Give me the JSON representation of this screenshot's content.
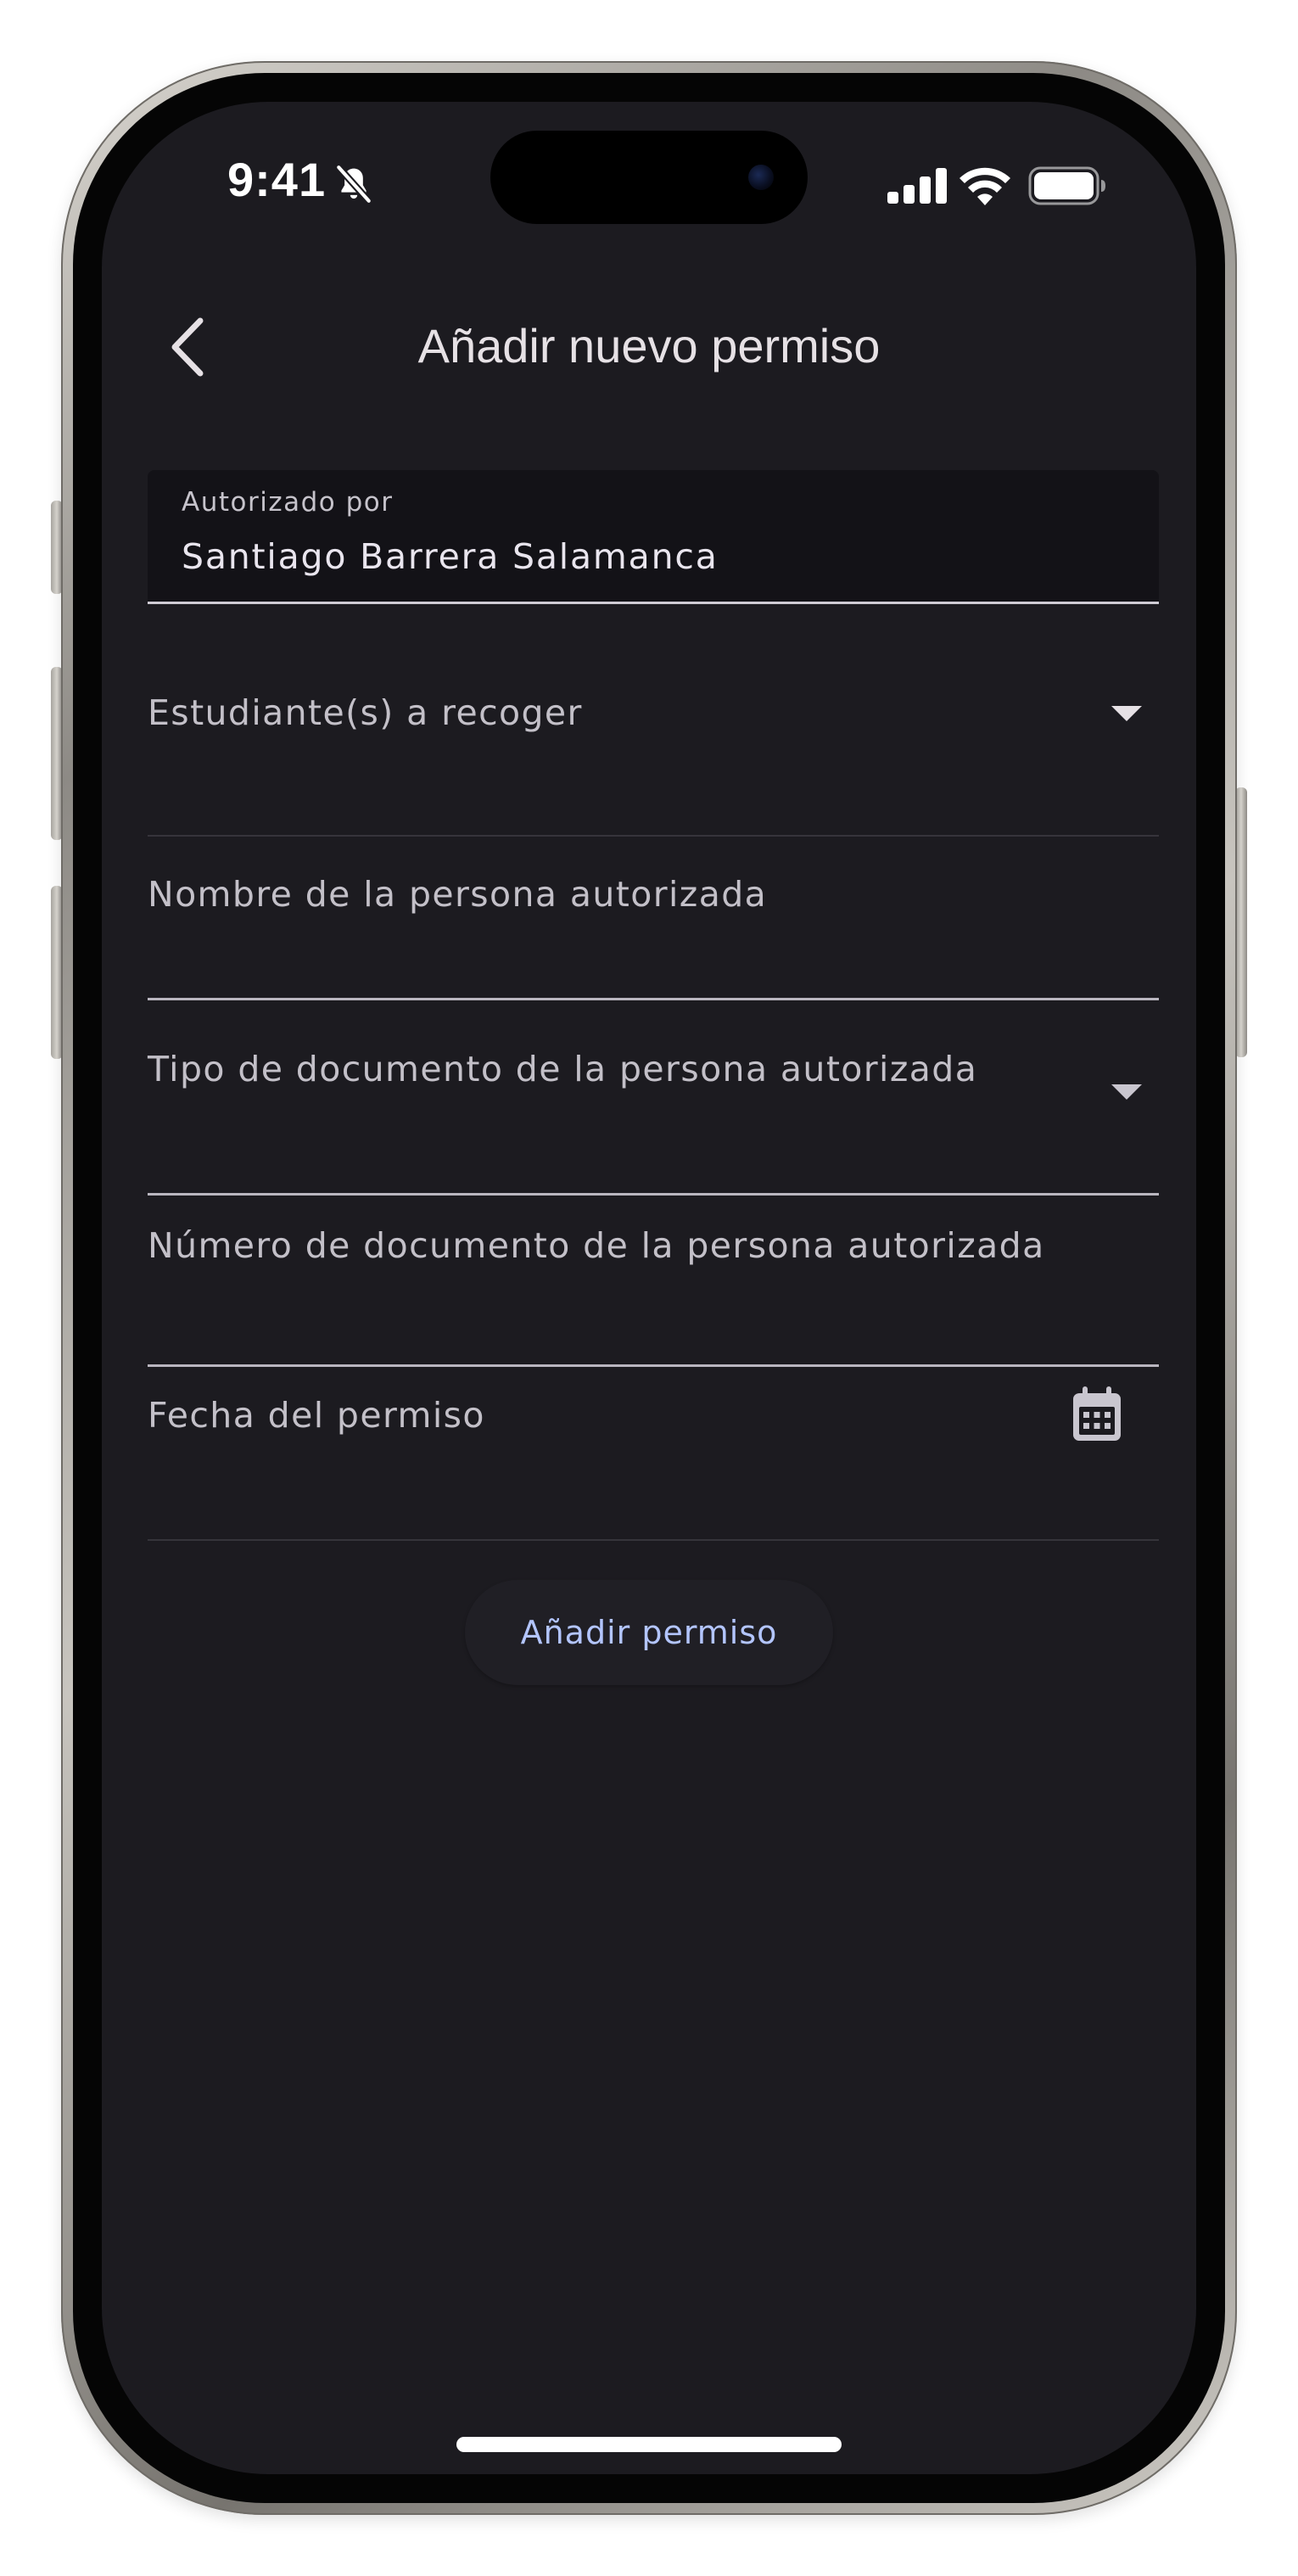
{
  "status_bar": {
    "time": "9:41"
  },
  "header": {
    "title": "Añadir nuevo permiso"
  },
  "form": {
    "authorized_by": {
      "label": "Autorizado por",
      "value": "Santiago Barrera Salamanca"
    },
    "students": {
      "label": "Estudiante(s) a recoger"
    },
    "authorized_name": {
      "label": "Nombre de la persona autorizada"
    },
    "document_type": {
      "label": "Tipo de documento de la persona autorizada"
    },
    "document_number": {
      "label": "Número de documento de la persona autorizada"
    },
    "permission_date": {
      "label": "Fecha del permiso"
    }
  },
  "actions": {
    "submit_label": "Añadir permiso"
  },
  "colors": {
    "background": "#1c1b20",
    "filled_field": "#131217",
    "accent": "#b3c5ff",
    "text": "#e6e1e5"
  },
  "icons": [
    "bell-slash-icon",
    "cellular-signal-icon",
    "wifi-icon",
    "battery-icon",
    "chevron-left-icon",
    "chevron-down-icon",
    "calendar-icon"
  ]
}
